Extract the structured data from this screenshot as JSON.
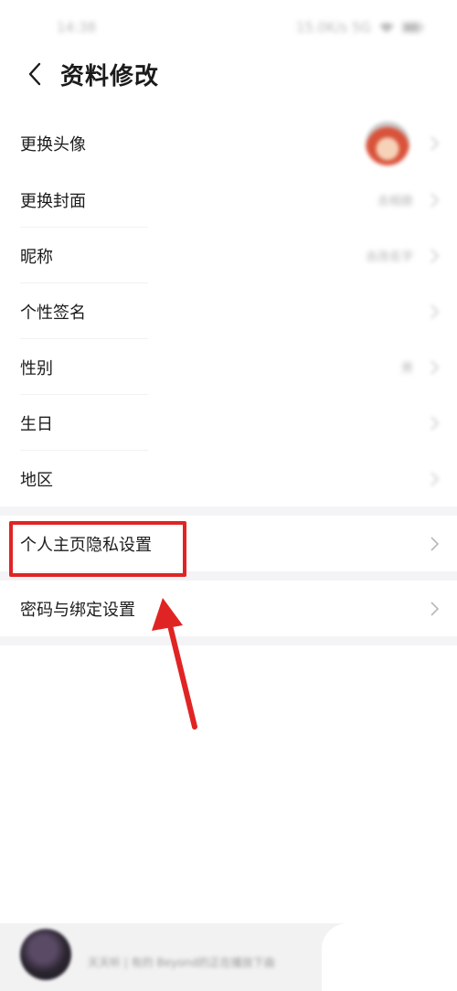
{
  "status": {
    "time": "14:38",
    "right": "15.0K/s 5G"
  },
  "nav": {
    "title": "资料修改"
  },
  "profile_rows": [
    {
      "label": "更换头像"
    },
    {
      "label": "更换封面",
      "value": "去相册"
    },
    {
      "label": "昵称",
      "value": "去改名字"
    },
    {
      "label": "个性签名"
    },
    {
      "label": "性别",
      "value": "男"
    },
    {
      "label": "生日"
    },
    {
      "label": "地区"
    }
  ],
  "settings_rows": [
    {
      "label": "个人主页隐私设置"
    },
    {
      "label": "密码与绑定设置"
    }
  ],
  "bottom": {
    "text": "天天听 | 有的 Beyond的正在播放下曲"
  },
  "colors": {
    "highlight": "#e02424",
    "arrow": "#e02424"
  }
}
